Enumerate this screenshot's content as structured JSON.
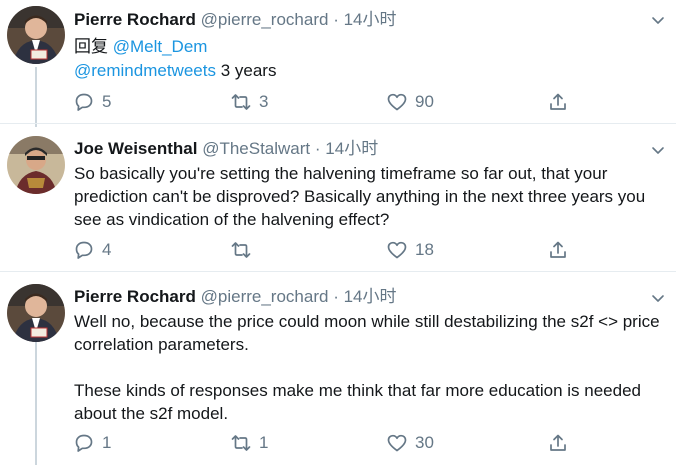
{
  "tweets": [
    {
      "name": "Pierre Rochard",
      "handle": "@pierre_rochard",
      "separator": "·",
      "time": "14小时",
      "reply_label": "回复",
      "reply_to": "@Melt_Dem",
      "mention": "@remindmetweets",
      "text": " 3 years",
      "replies": "5",
      "retweets": "3",
      "likes": "90"
    },
    {
      "name": "Joe Weisenthal",
      "handle": "@TheStalwart",
      "separator": "·",
      "time": "14小时",
      "text": "So basically you're setting the halvening timeframe so far out, that your prediction can't be disproved? Basically anything in the next three years you see as vindication of the halvening effect?",
      "replies": "4",
      "retweets": "",
      "likes": "18"
    },
    {
      "name": "Pierre Rochard",
      "handle": "@pierre_rochard",
      "separator": "·",
      "time": "14小时",
      "text": "Well no, because the price could moon while still destabilizing the s2f <> price correlation parameters.\n\nThese kinds of responses make me think that far more education is needed about the s2f model.",
      "replies": "1",
      "retweets": "1",
      "likes": "30"
    }
  ],
  "icons": {
    "reply": "reply-icon",
    "retweet": "retweet-icon",
    "like": "heart-icon",
    "share": "share-icon",
    "more": "chevron-down-icon"
  },
  "colors": {
    "link": "#1b95e0",
    "secondary": "#657786",
    "thread_line": "#ccd6dd"
  }
}
